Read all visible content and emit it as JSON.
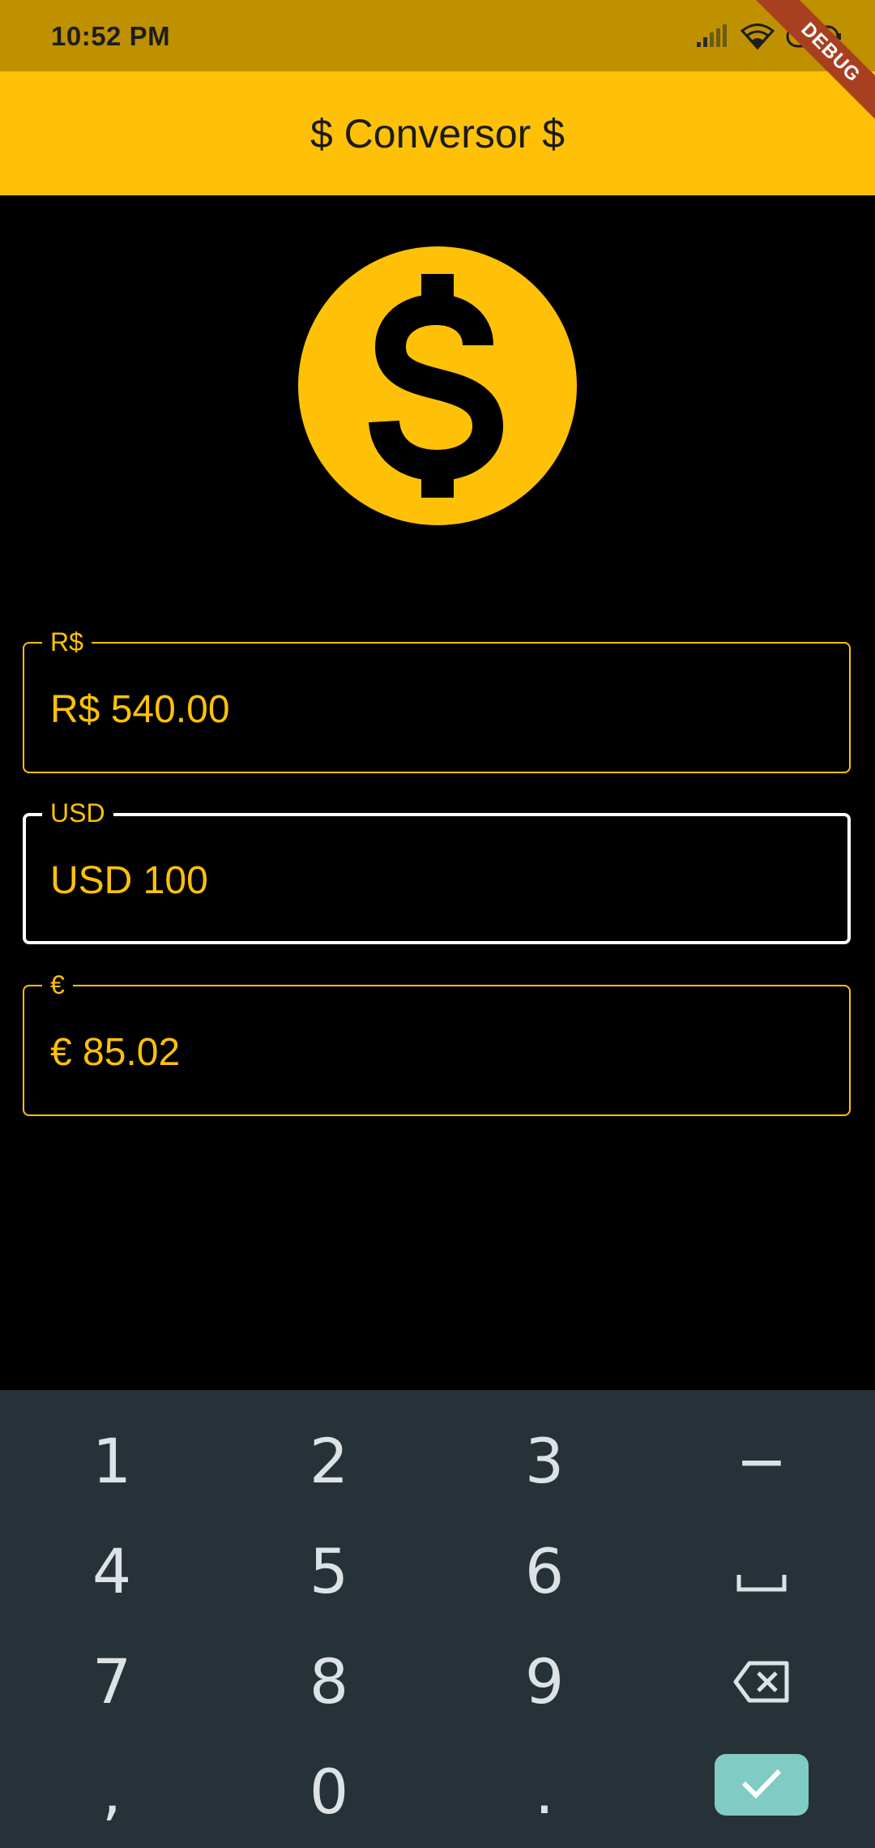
{
  "status_bar": {
    "time": "10:52 PM",
    "icons": [
      "signal-icon",
      "wifi-icon",
      "battery-icon"
    ]
  },
  "debug_banner": "DEBUG",
  "app_bar": {
    "title": "$ Conversor $"
  },
  "logo": {
    "icon": "dollar-icon"
  },
  "fields": [
    {
      "label": "R$",
      "value": "R$ 540.00",
      "focused": false
    },
    {
      "label": "USD",
      "value": "USD 100",
      "focused": true
    },
    {
      "label": "€",
      "value": "€ 85.02",
      "focused": false
    }
  ],
  "keyboard": {
    "keys": [
      "1",
      "2",
      "3",
      "−",
      "4",
      "5",
      "6",
      "␣",
      "7",
      "8",
      "9",
      ",",
      "0",
      "."
    ],
    "backspace_icon": "backspace-icon",
    "done_icon": "check-icon"
  },
  "colors": {
    "accent": "#FFC107",
    "status_bar": "#BF9100",
    "background": "#000000",
    "keyboard": "#263238",
    "done_key": "#80CBC4"
  }
}
